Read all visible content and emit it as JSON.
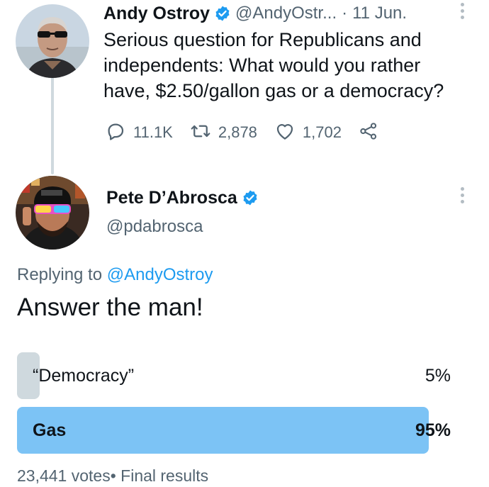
{
  "tweet1": {
    "name": "Andy Ostroy",
    "handle": "@AndyOstr...",
    "separator": "·",
    "date": "11 Jun.",
    "text": "Serious question for Republicans and independents: What would you rather have, $2.50/gallon gas or a democracy?",
    "replies": "11.1K",
    "retweets": "2,878",
    "likes": "1,702"
  },
  "tweet2": {
    "name": "Pete D’Abrosca",
    "handle": "@pdabrosca",
    "replying_prefix": "Replying to ",
    "replying_to": "@AndyOstroy",
    "text": "Answer the man!"
  },
  "poll": {
    "options": [
      {
        "label": "“Democracy”",
        "percent_label": "5%",
        "share": 0.05,
        "winner": false
      },
      {
        "label": "Gas",
        "percent_label": "95%",
        "share": 0.95,
        "winner": true
      }
    ],
    "footer": "23,441 votes• Final results"
  },
  "colors": {
    "accent": "#1d9bf0",
    "winner_fill": "#7cc3f5",
    "loser_fill": "#cfd9de",
    "muted_text": "#536471"
  },
  "icons": {
    "verified": "verified-badge-icon",
    "reply": "reply-icon",
    "retweet": "retweet-icon",
    "like": "heart-icon",
    "share": "share-icon",
    "more": "more-options-icon"
  }
}
